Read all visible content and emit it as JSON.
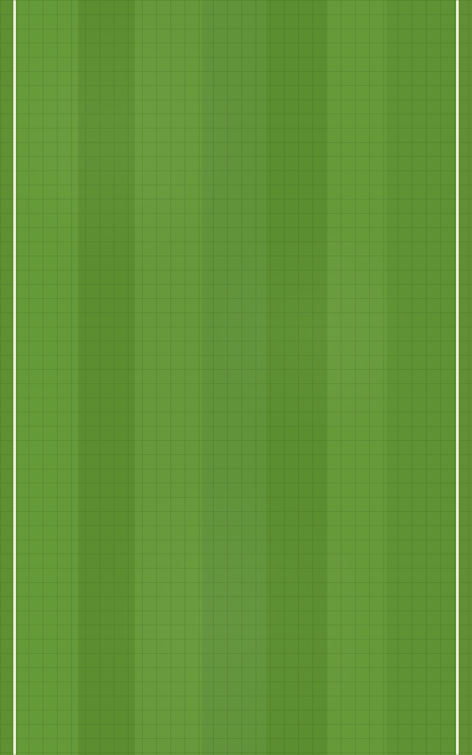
{
  "scene": {
    "name": "soccer-pitch-track",
    "colors": {
      "grass_light": "#669a39",
      "grass_dark": "#5b8e30",
      "grid": "#4f7d2a",
      "line": "#eef1d9"
    }
  }
}
